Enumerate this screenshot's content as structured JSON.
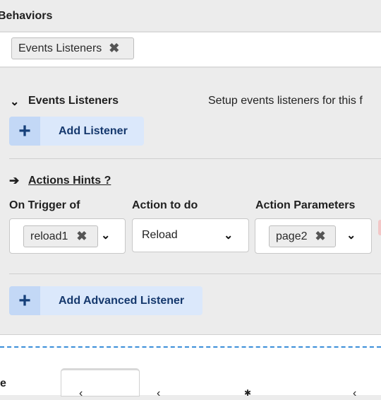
{
  "section": {
    "title": "Behaviors"
  },
  "tag_bar": {
    "tag_label": "Events Listeners",
    "remove_icon": "close-icon"
  },
  "events": {
    "title": "Events Listeners",
    "description": "Setup events listeners for this f",
    "add_label": "Add Listener"
  },
  "hints": {
    "arrow": "➔",
    "label": "Actions Hints ?"
  },
  "table": {
    "headers": [
      "On Trigger of",
      "Action to do",
      "Action Parameters"
    ],
    "trigger_tag": "reload1",
    "action_value": "Reload",
    "param_tag": "page2"
  },
  "advanced": {
    "add_label": "Add Advanced Listener"
  },
  "bottom": {
    "label_fragment": "e"
  }
}
